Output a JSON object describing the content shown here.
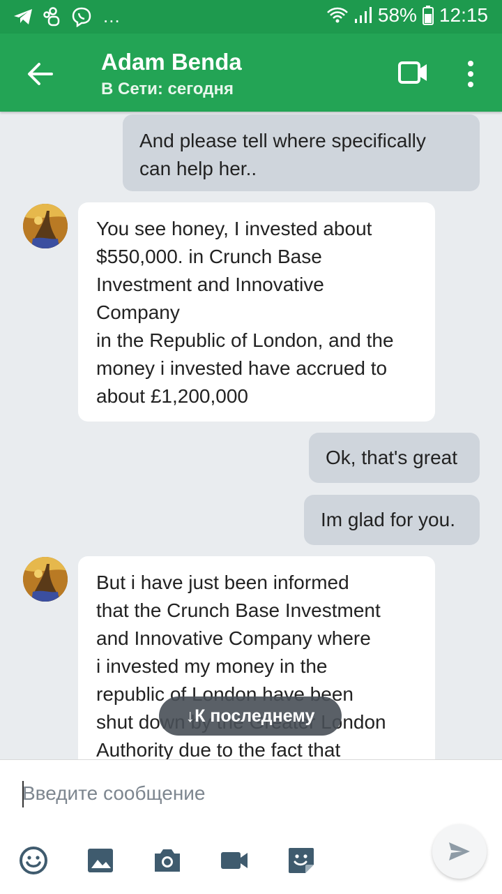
{
  "status_bar": {
    "battery": "58%",
    "time": "12:15",
    "more_indicator": "..."
  },
  "header": {
    "contact_name": "Adam Benda",
    "presence": "В Сети: сегодня"
  },
  "messages": [
    {
      "direction": "outgoing",
      "text": "And please tell where specifically\ncan help her.."
    },
    {
      "direction": "incoming",
      "text": "You see honey, I invested about\n$550,000. in Crunch Base\nInvestment and Innovative\nCompany\nin the Republic of London, and the\nmoney i invested have accrued to\nabout £1,200,000"
    },
    {
      "direction": "outgoing",
      "text": "Ok, that's great"
    },
    {
      "direction": "outgoing",
      "text": "Im glad for you."
    },
    {
      "direction": "incoming",
      "text": "But i have just been informed\nthat the Crunch Base Investment\nand Innovative Company where\ni invested my money in the\nrepublic of London have been\nshut down by the Greater London\nAuthority due to the fact that"
    }
  ],
  "jump_to_latest": {
    "label": "↓К последнему"
  },
  "composer": {
    "placeholder": "Введите сообщение",
    "tools": [
      "emoji-icon",
      "gallery-icon",
      "camera-icon",
      "video-icon",
      "sticker-icon"
    ]
  },
  "colors": {
    "status_bar": "#1e9a4e",
    "app_bar": "#23a455",
    "outgoing_bubble": "#cfd5dc",
    "incoming_bubble": "#ffffff",
    "chat_background": "#e9ecef"
  }
}
